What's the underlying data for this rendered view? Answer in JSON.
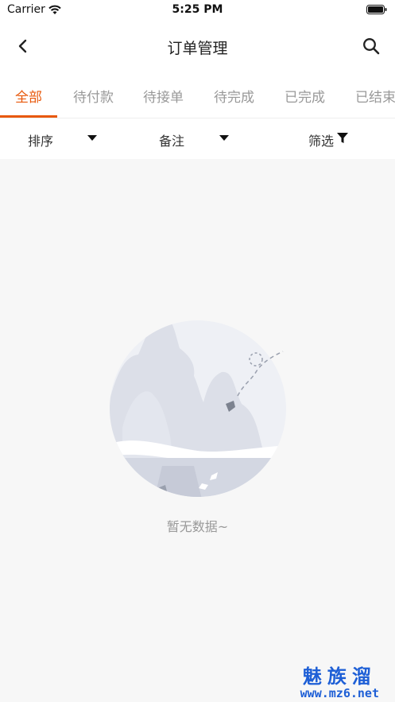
{
  "status_bar": {
    "carrier": "Carrier",
    "time": "5:25 PM",
    "icons": [
      "wifi-icon",
      "battery-icon"
    ]
  },
  "nav": {
    "title": "订单管理",
    "back_icon": "chevron-left-icon",
    "search_icon": "search-icon"
  },
  "tabs": [
    {
      "label": "全部",
      "active": true
    },
    {
      "label": "待付款",
      "active": false
    },
    {
      "label": "待接单",
      "active": false
    },
    {
      "label": "待完成",
      "active": false
    },
    {
      "label": "已完成",
      "active": false
    },
    {
      "label": "已结束",
      "active": false
    }
  ],
  "filters": {
    "sort_label": "排序",
    "remark_label": "备注",
    "filter_label": "筛选"
  },
  "empty_state": {
    "text": "暂无数据~",
    "illustration_icon": "empty-mountain-illustration"
  },
  "watermark": {
    "brand": "魅族溜",
    "url": "www.mz6.net"
  },
  "colors": {
    "accent": "#e8580b",
    "background": "#f7f7f7",
    "muted_text": "#999999",
    "watermark": "#1e5fd6"
  }
}
